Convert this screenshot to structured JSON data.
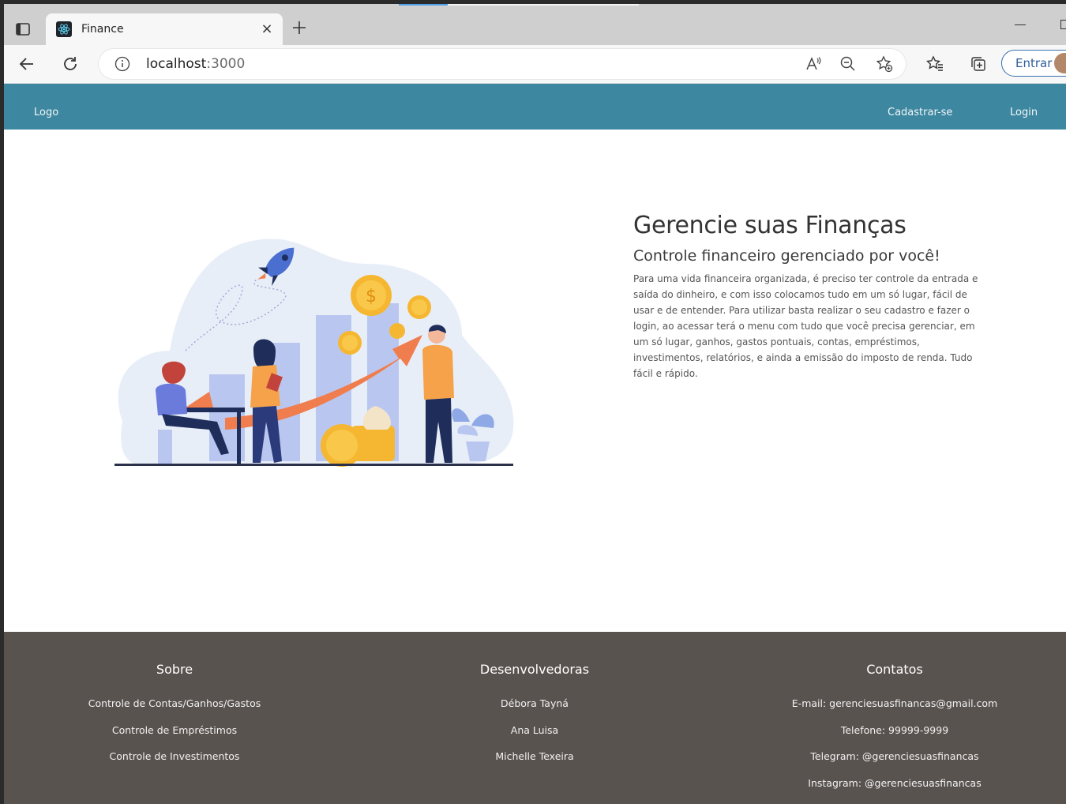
{
  "browser": {
    "tab_title": "Finance",
    "url_host": "localhost",
    "url_port": ":3000",
    "signin_label": "Entrar",
    "tab_close": "×"
  },
  "nav": {
    "logo": "Logo",
    "signup": "Cadastrar-se",
    "login": "Login"
  },
  "hero": {
    "title": "Gerencie suas Finanças",
    "subtitle": "Controle financeiro gerenciado por você!",
    "description": "Para uma vida financeira organizada, é preciso ter controle da entrada e saída do dinheiro, e com isso colocamos tudo em um só lugar, fácil de usar e de entender. Para utilizar basta realizar o seu cadastro e fazer o login, ao acessar terá o menu com tudo que você precisa gerenciar, em um só lugar, ganhos, gastos pontuais, contas, empréstimos, investimentos, relatórios, e ainda a emissão do imposto de renda. Tudo fácil e rápido."
  },
  "footer": {
    "sobre": {
      "title": "Sobre",
      "items": [
        "Controle de Contas/Ganhos/Gastos",
        "Controle de Empréstimos",
        "Controle de Investimentos"
      ]
    },
    "devs": {
      "title": "Desenvolvedoras",
      "items": [
        "Débora Tayná",
        "Ana Luisa",
        "Michelle Texeira"
      ]
    },
    "contatos": {
      "title": "Contatos",
      "items": [
        "E-mail: gerenciesuasfinancas@gmail.com",
        "Telefone: 99999-9999",
        "Telegram: @gerenciesuasfinancas",
        "Instagram: @gerenciesuasfinancas"
      ]
    }
  },
  "colors": {
    "navbar": "#3e87a0",
    "footer": "#59534f",
    "accent_orange": "#f07d4d",
    "coin": "#f5b731"
  }
}
